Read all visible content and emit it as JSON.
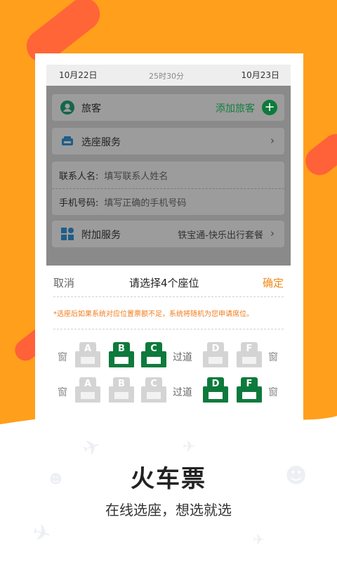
{
  "colors": {
    "background": "#ff9f1c",
    "accent_orange": "#f08a1c",
    "selected_green": "#0d7a3c",
    "unavailable_gray": "#d4d4d4"
  },
  "booking": {
    "depart_date": "10月22日",
    "duration": "25时30分",
    "arrive_date": "10月23日",
    "passenger_label": "旅客",
    "add_passenger": "添加旅客",
    "seat_service_label": "选座服务",
    "contact_name_label": "联系人名:",
    "contact_name_placeholder": "填写联系人姓名",
    "phone_label": "手机号码:",
    "phone_placeholder": "填写正确的手机号码",
    "extra_service_label": "附加服务",
    "extra_service_value": "铁宝通-快乐出行套餐"
  },
  "seat_picker": {
    "cancel": "取消",
    "title": "请选择4个座位",
    "confirm": "确定",
    "notice": "*选座后如果系统对应位置票额不足，系统将随机为您申请席位。",
    "window": "窗",
    "aisle": "过道",
    "rows": [
      {
        "seats": [
          {
            "letter": "A",
            "selected": false
          },
          {
            "letter": "B",
            "selected": true
          },
          {
            "letter": "C",
            "selected": true
          },
          {
            "letter": "D",
            "selected": false
          },
          {
            "letter": "F",
            "selected": false
          }
        ]
      },
      {
        "seats": [
          {
            "letter": "A",
            "selected": false
          },
          {
            "letter": "B",
            "selected": false
          },
          {
            "letter": "C",
            "selected": false
          },
          {
            "letter": "D",
            "selected": true
          },
          {
            "letter": "F",
            "selected": true
          }
        ]
      }
    ]
  },
  "promo": {
    "title": "火车票",
    "subtitle": "在线选座，想选就选"
  }
}
